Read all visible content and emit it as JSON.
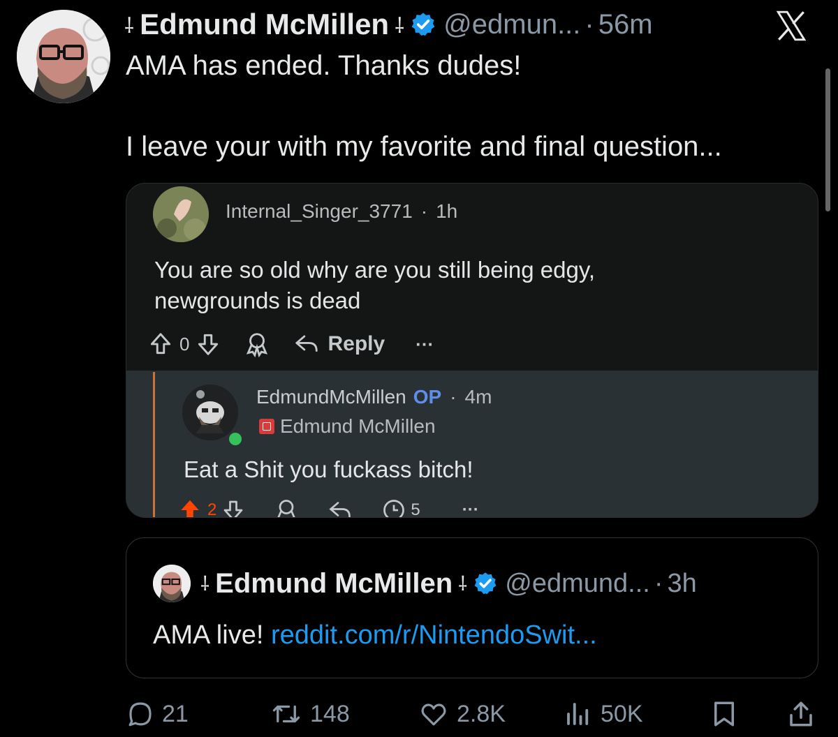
{
  "tweet": {
    "author_name": "Edmund McMillen",
    "name_symbol": "⸸",
    "handle": "@edmun...",
    "separator": "·",
    "time": "56m",
    "text_line1": "AMA has ended. Thanks dudes!",
    "text_line2": "I leave your with my favorite and final question..."
  },
  "reddit": {
    "comment": {
      "user": "Internal_Singer_3771",
      "separator": "·",
      "time": "1h",
      "text_line1": "You are so old why are you still being edgy,",
      "text_line2": "newgrounds is dead",
      "score": "0",
      "reply_label": "Reply",
      "more": "···"
    },
    "reply": {
      "user": "EdmundMcMillen",
      "op_badge": "OP",
      "separator": "·",
      "time": "4m",
      "flair": "Edmund McMillen",
      "text": "Eat a Shit you fuckass bitch!",
      "score": "2",
      "awards": "5",
      "more": "···"
    }
  },
  "quote": {
    "author_name": "Edmund McMillen",
    "name_symbol": "⸸",
    "handle": "@edmund...",
    "separator": "·",
    "time": "3h",
    "text": "AMA live!",
    "link": "reddit.com/r/NintendoSwit..."
  },
  "actions": {
    "replies": "21",
    "retweets": "148",
    "likes": "2.8K",
    "views": "50K"
  },
  "colors": {
    "background": "#000000",
    "link": "#1d9bf0",
    "verified": "#1d9bf0",
    "upvote_active": "#ff4500",
    "op_badge": "#5e8ee8",
    "flair": "#d93a3a"
  }
}
